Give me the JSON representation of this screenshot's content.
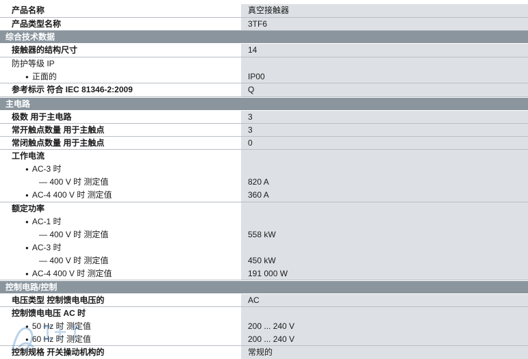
{
  "rows": {
    "product_name": {
      "label": "产品名称",
      "value": "真空接触器"
    },
    "product_type": {
      "label": "产品类型名称",
      "value": "3TF6"
    },
    "section_general": "综合技术数据",
    "size": {
      "label": "接触器的结构尺寸",
      "value": "14"
    },
    "ip": {
      "label": "防护等级 IP",
      "value": ""
    },
    "ip_front": {
      "label": "正面的",
      "value": "IP00"
    },
    "ref": {
      "label": "参考标示 符合 IEC 81346-2:2009",
      "value": "Q"
    },
    "section_main": "主电路",
    "poles": {
      "label": "极数 用于主电路",
      "value": "3"
    },
    "no_contacts": {
      "label": "常开触点数量 用于主触点",
      "value": "3"
    },
    "nc_contacts": {
      "label": "常闭触点数量 用于主触点",
      "value": "0"
    },
    "op_current": {
      "label": "工作电流",
      "value": ""
    },
    "ac3": {
      "label": "AC-3 时",
      "value": ""
    },
    "ac3_400": {
      "label": "— 400 V 时 测定值",
      "value": "820 A"
    },
    "ac4_400": {
      "label": "AC-4 400 V 时 测定值",
      "value": "360 A"
    },
    "rated_power": {
      "label": "额定功率",
      "value": ""
    },
    "ac1": {
      "label": "AC-1 时",
      "value": ""
    },
    "ac1_400": {
      "label": "— 400 V 时 测定值",
      "value": "558 kW"
    },
    "ac3b": {
      "label": "AC-3 时",
      "value": ""
    },
    "ac3b_400": {
      "label": "— 400 V 时 测定值",
      "value": "450 kW"
    },
    "ac4b_400": {
      "label": "AC-4 400 V 时 测定值",
      "value": "191 000 W"
    },
    "section_control": "控制电路/控制",
    "voltage_type": {
      "label": "电压类型 控制馈电电压的",
      "value": "AC"
    },
    "ctrl_ac": {
      "label": "控制馈电电压 AC 时",
      "value": ""
    },
    "hz50": {
      "label": "50 Hz 时 测定值",
      "value": "200 ... 240 V"
    },
    "hz60": {
      "label": "60 Hz 时 测定值",
      "value": "200 ... 240 V"
    },
    "ctrl_spec": {
      "label": "控制规格 开关操动机构的",
      "value": "常规的"
    }
  },
  "watermark_icon": "watermark-logo-icon",
  "colors": {
    "section_bg": "#8a959e",
    "value_bg": "#dde1e5",
    "line": "#b8bec4"
  }
}
